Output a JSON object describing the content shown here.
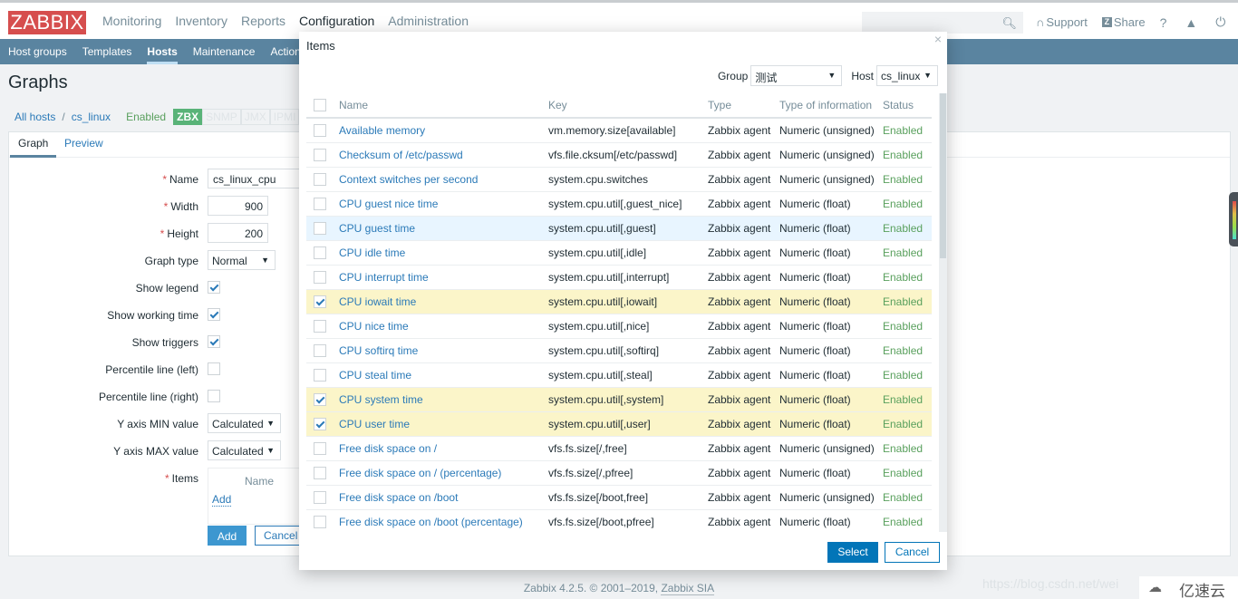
{
  "header": {
    "logo": "ZABBIX",
    "main_nav": [
      {
        "label": "Monitoring",
        "active": false
      },
      {
        "label": "Inventory",
        "active": false
      },
      {
        "label": "Reports",
        "active": false
      },
      {
        "label": "Configuration",
        "active": true
      },
      {
        "label": "Administration",
        "active": false
      }
    ],
    "search_placeholder": "",
    "support_label": "Support",
    "share_label": "Share",
    "share_icon_glyph": "Z",
    "help_label": "?"
  },
  "sub_nav": [
    {
      "label": "Host groups",
      "active": false
    },
    {
      "label": "Templates",
      "active": false
    },
    {
      "label": "Hosts",
      "active": true
    },
    {
      "label": "Maintenance",
      "active": false
    },
    {
      "label": "Actions",
      "active": false
    }
  ],
  "page_title": "Graphs",
  "breadcrumbs": {
    "all_hosts": "All hosts",
    "separator": "/",
    "host": "cs_linux",
    "status": "Enabled",
    "protocols": [
      "ZBX",
      "SNMP",
      "JMX",
      "IPMI"
    ]
  },
  "tabs": [
    {
      "label": "Graph",
      "active": true
    },
    {
      "label": "Preview",
      "active": false
    }
  ],
  "form": {
    "name_label": "Name",
    "name_value": "cs_linux_cpu",
    "width_label": "Width",
    "width_value": "900",
    "height_label": "Height",
    "height_value": "200",
    "graph_type_label": "Graph type",
    "graph_type_value": "Normal",
    "show_legend_label": "Show legend",
    "show_legend": true,
    "show_working_time_label": "Show working time",
    "show_working_time": true,
    "show_triggers_label": "Show triggers",
    "show_triggers": true,
    "percentile_left_label": "Percentile line (left)",
    "percentile_left": false,
    "percentile_right_label": "Percentile line (right)",
    "percentile_right": false,
    "ymin_label": "Y axis MIN value",
    "ymin_value": "Calculated",
    "ymax_label": "Y axis MAX value",
    "ymax_value": "Calculated",
    "items_label": "Items",
    "items_name_header": "Name",
    "items_add_link": "Add",
    "required_mark": "*",
    "add_button": "Add",
    "cancel_button": "Cancel"
  },
  "modal": {
    "title": "Items",
    "close_glyph": "×",
    "group_label": "Group",
    "group_value": "测试",
    "host_label": "Host",
    "host_value": "cs_linux",
    "columns": [
      "Name",
      "Key",
      "Type",
      "Type of information",
      "Status"
    ],
    "rows": [
      {
        "name": "Available memory",
        "key": "vm.memory.size[available]",
        "type": "Zabbix agent",
        "info": "Numeric (unsigned)",
        "status": "Enabled",
        "checked": false
      },
      {
        "name": "Checksum of /etc/passwd",
        "key": "vfs.file.cksum[/etc/passwd]",
        "type": "Zabbix agent",
        "info": "Numeric (unsigned)",
        "status": "Enabled",
        "checked": false
      },
      {
        "name": "Context switches per second",
        "key": "system.cpu.switches",
        "type": "Zabbix agent",
        "info": "Numeric (unsigned)",
        "status": "Enabled",
        "checked": false
      },
      {
        "name": "CPU guest nice time",
        "key": "system.cpu.util[,guest_nice]",
        "type": "Zabbix agent",
        "info": "Numeric (float)",
        "status": "Enabled",
        "checked": false
      },
      {
        "name": "CPU guest time",
        "key": "system.cpu.util[,guest]",
        "type": "Zabbix agent",
        "info": "Numeric (float)",
        "status": "Enabled",
        "checked": false,
        "hover": true
      },
      {
        "name": "CPU idle time",
        "key": "system.cpu.util[,idle]",
        "type": "Zabbix agent",
        "info": "Numeric (float)",
        "status": "Enabled",
        "checked": false
      },
      {
        "name": "CPU interrupt time",
        "key": "system.cpu.util[,interrupt]",
        "type": "Zabbix agent",
        "info": "Numeric (float)",
        "status": "Enabled",
        "checked": false
      },
      {
        "name": "CPU iowait time",
        "key": "system.cpu.util[,iowait]",
        "type": "Zabbix agent",
        "info": "Numeric (float)",
        "status": "Enabled",
        "checked": true
      },
      {
        "name": "CPU nice time",
        "key": "system.cpu.util[,nice]",
        "type": "Zabbix agent",
        "info": "Numeric (float)",
        "status": "Enabled",
        "checked": false
      },
      {
        "name": "CPU softirq time",
        "key": "system.cpu.util[,softirq]",
        "type": "Zabbix agent",
        "info": "Numeric (float)",
        "status": "Enabled",
        "checked": false
      },
      {
        "name": "CPU steal time",
        "key": "system.cpu.util[,steal]",
        "type": "Zabbix agent",
        "info": "Numeric (float)",
        "status": "Enabled",
        "checked": false
      },
      {
        "name": "CPU system time",
        "key": "system.cpu.util[,system]",
        "type": "Zabbix agent",
        "info": "Numeric (float)",
        "status": "Enabled",
        "checked": true
      },
      {
        "name": "CPU user time",
        "key": "system.cpu.util[,user]",
        "type": "Zabbix agent",
        "info": "Numeric (float)",
        "status": "Enabled",
        "checked": true
      },
      {
        "name": "Free disk space on /",
        "key": "vfs.fs.size[/,free]",
        "type": "Zabbix agent",
        "info": "Numeric (unsigned)",
        "status": "Enabled",
        "checked": false
      },
      {
        "name": "Free disk space on / (percentage)",
        "key": "vfs.fs.size[/,pfree]",
        "type": "Zabbix agent",
        "info": "Numeric (float)",
        "status": "Enabled",
        "checked": false
      },
      {
        "name": "Free disk space on /boot",
        "key": "vfs.fs.size[/boot,free]",
        "type": "Zabbix agent",
        "info": "Numeric (unsigned)",
        "status": "Enabled",
        "checked": false
      },
      {
        "name": "Free disk space on /boot (percentage)",
        "key": "vfs.fs.size[/boot,pfree]",
        "type": "Zabbix agent",
        "info": "Numeric (float)",
        "status": "Enabled",
        "checked": false
      }
    ],
    "select_button": "Select",
    "cancel_button": "Cancel"
  },
  "footer": {
    "text": "Zabbix 4.2.5. © 2001–2019, ",
    "link": "Zabbix SIA"
  },
  "watermark": {
    "url": "https://blog.csdn.net/wei",
    "brand": "亿速云"
  }
}
